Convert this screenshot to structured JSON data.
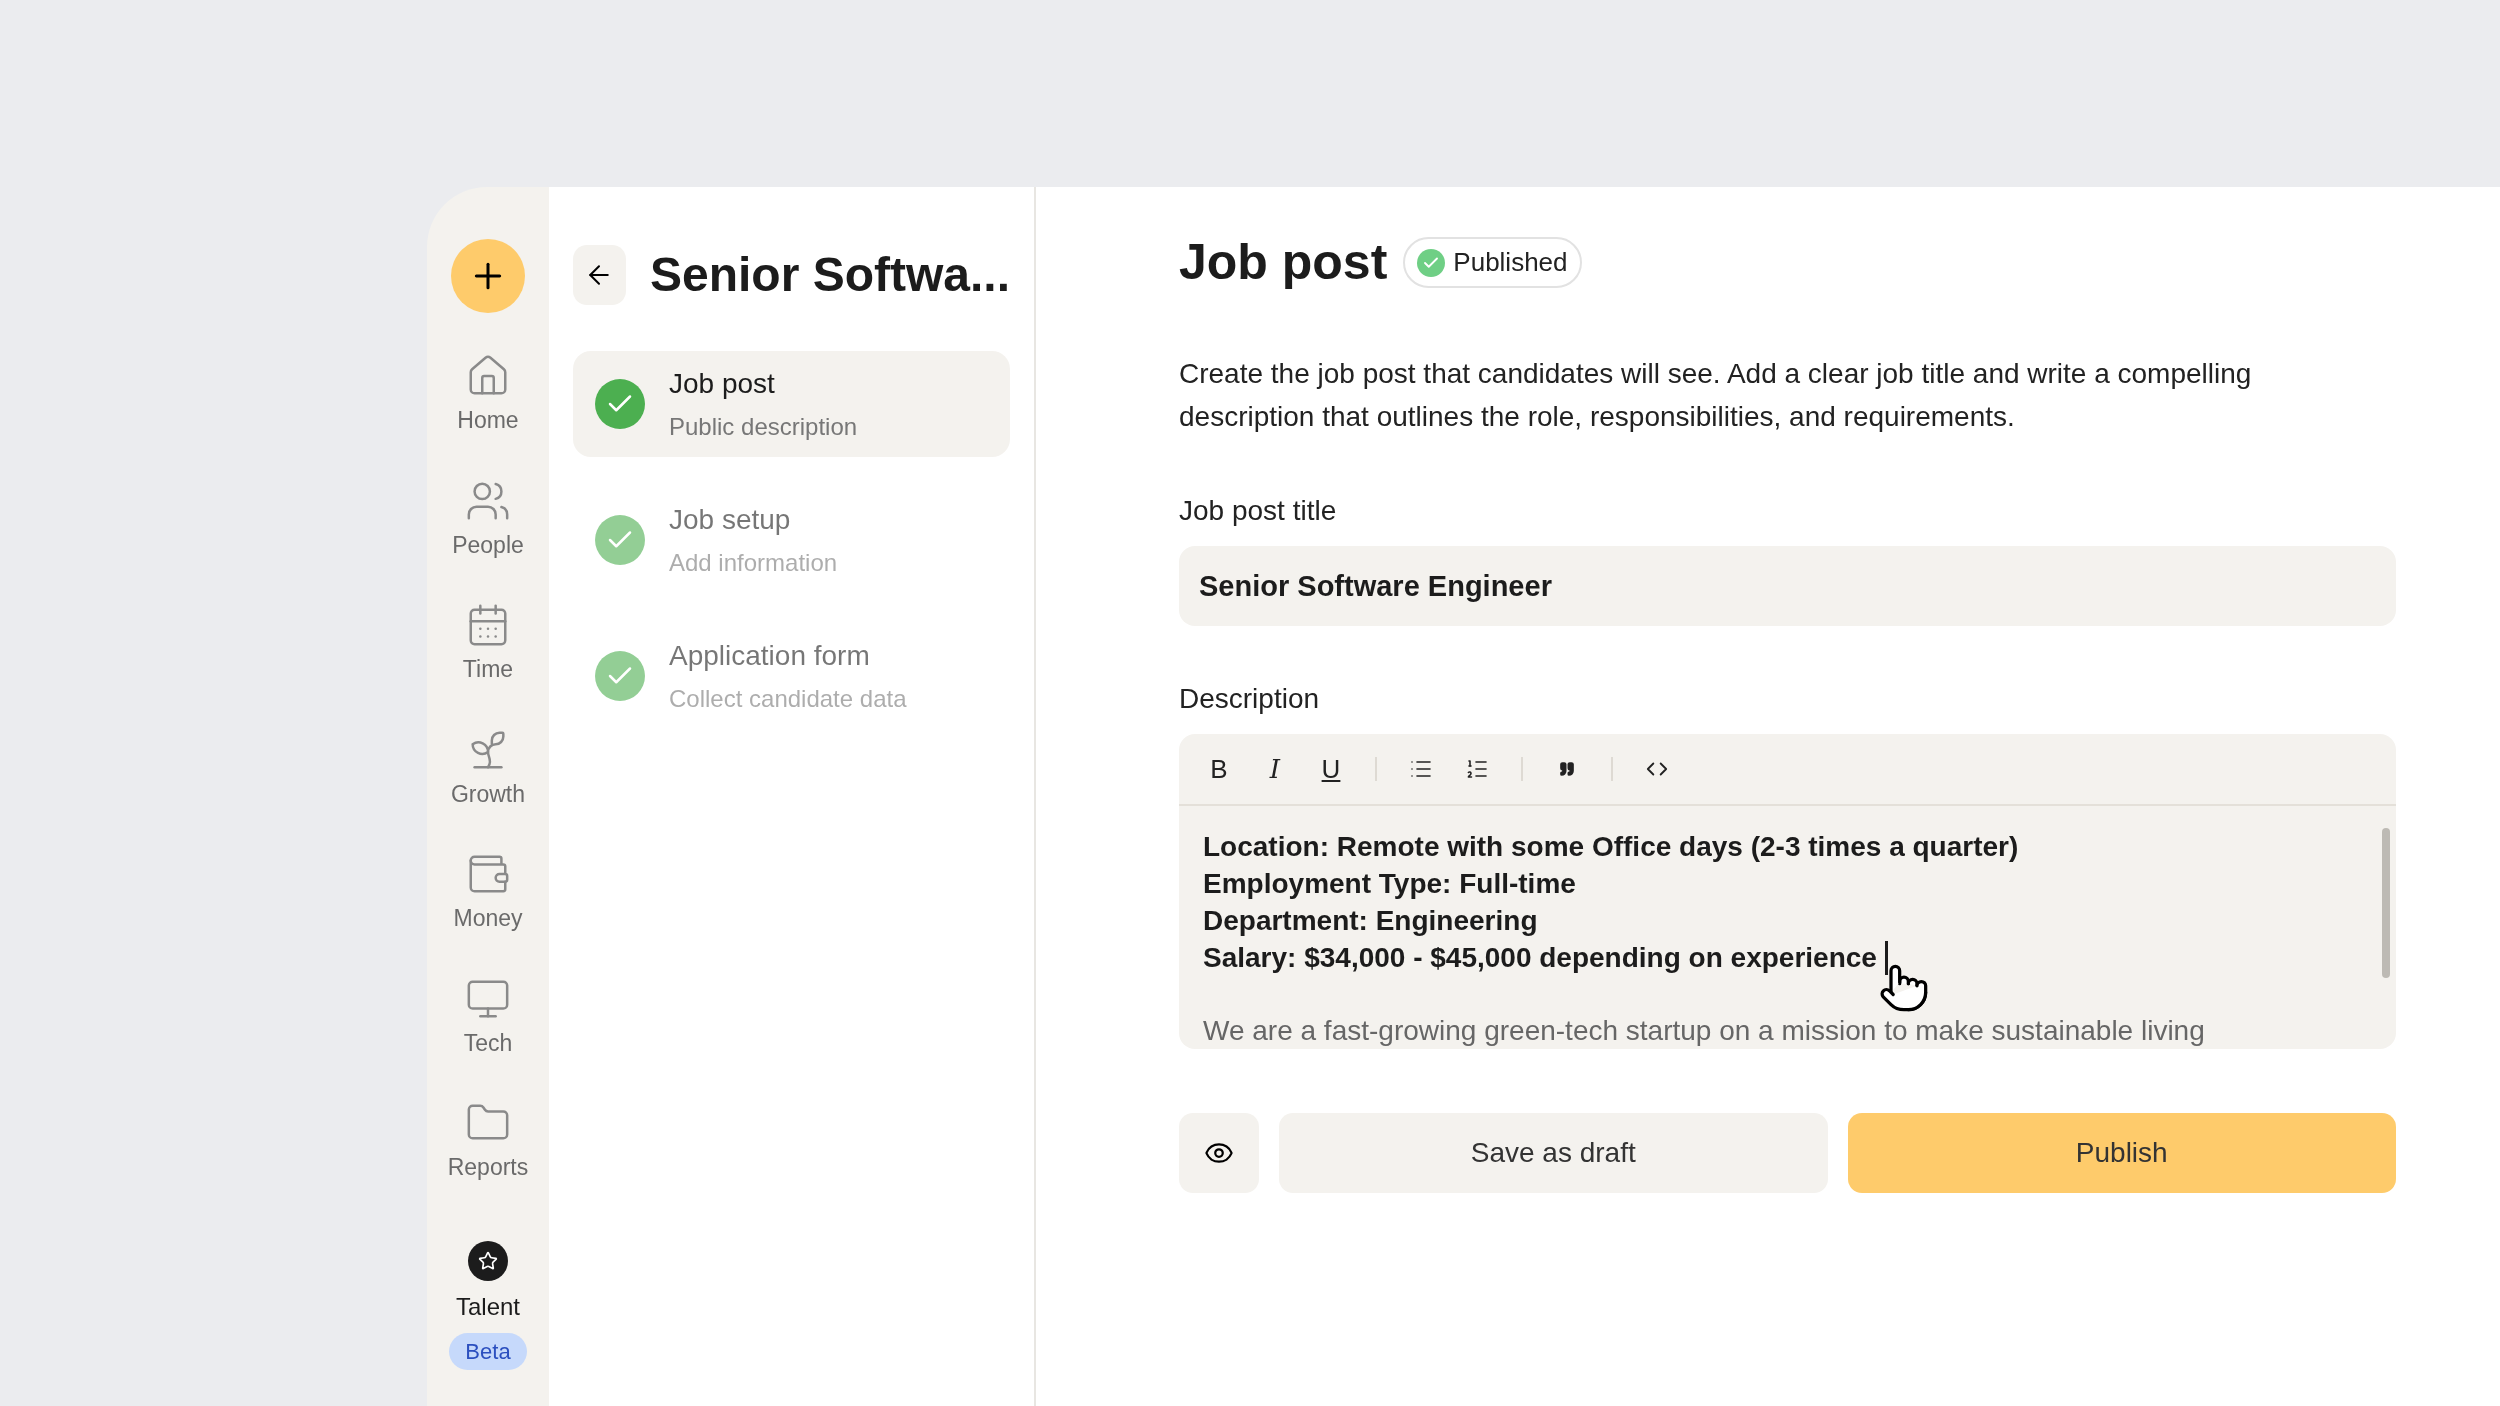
{
  "nav": {
    "items": [
      {
        "kind": "home",
        "label": "Home",
        "selected": false
      },
      {
        "kind": "people",
        "label": "People",
        "selected": false
      },
      {
        "kind": "time",
        "label": "Time",
        "selected": false
      },
      {
        "kind": "growth",
        "label": "Growth",
        "selected": false
      },
      {
        "kind": "money",
        "label": "Money",
        "selected": false
      },
      {
        "kind": "tech",
        "label": "Tech",
        "selected": false
      },
      {
        "kind": "reports",
        "label": "Reports",
        "selected": false
      },
      {
        "kind": "talent",
        "label": "Talent",
        "selected": true,
        "badge": "Beta"
      }
    ]
  },
  "steps_panel": {
    "title": "Senior Softwa...",
    "steps": [
      {
        "title": "Job post",
        "subtitle": "Public description",
        "selected": true,
        "done": true
      },
      {
        "title": "Job setup",
        "subtitle": "Add information",
        "selected": false,
        "done": true
      },
      {
        "title": "Application form",
        "subtitle": "Collect candidate data",
        "selected": false,
        "done": true
      }
    ]
  },
  "main": {
    "heading": "Job post",
    "status": "Published",
    "intro": "Create the job post that candidates will see. Add a clear job title and write a compelling description that outlines the role, responsibilities, and requirements.",
    "title_field": {
      "label": "Job post title",
      "value": "Senior Software Engineer"
    },
    "description": {
      "label": "Description",
      "toolbar": [
        {
          "kind": "bold",
          "text": "B"
        },
        {
          "kind": "italic",
          "text": "I"
        },
        {
          "kind": "underline",
          "text": "U"
        },
        {
          "kind": "divider"
        },
        {
          "kind": "bullets"
        },
        {
          "kind": "numbers"
        },
        {
          "kind": "divider"
        },
        {
          "kind": "quote"
        },
        {
          "kind": "divider"
        },
        {
          "kind": "code"
        }
      ],
      "lines": [
        "Location: Remote with some Office days (2-3 times a quarter)",
        "Employment Type: Full-time",
        "Department: Engineering",
        "Salary: $34,000 - $45,000 depending on experience"
      ],
      "paragraph": "We are a fast-growing green-tech startup on a mission to make sustainable living"
    },
    "buttons": [
      {
        "kind": "preview"
      },
      {
        "kind": "secondary",
        "label": "Save as draft"
      },
      {
        "kind": "primary",
        "label": "Publish"
      }
    ]
  }
}
